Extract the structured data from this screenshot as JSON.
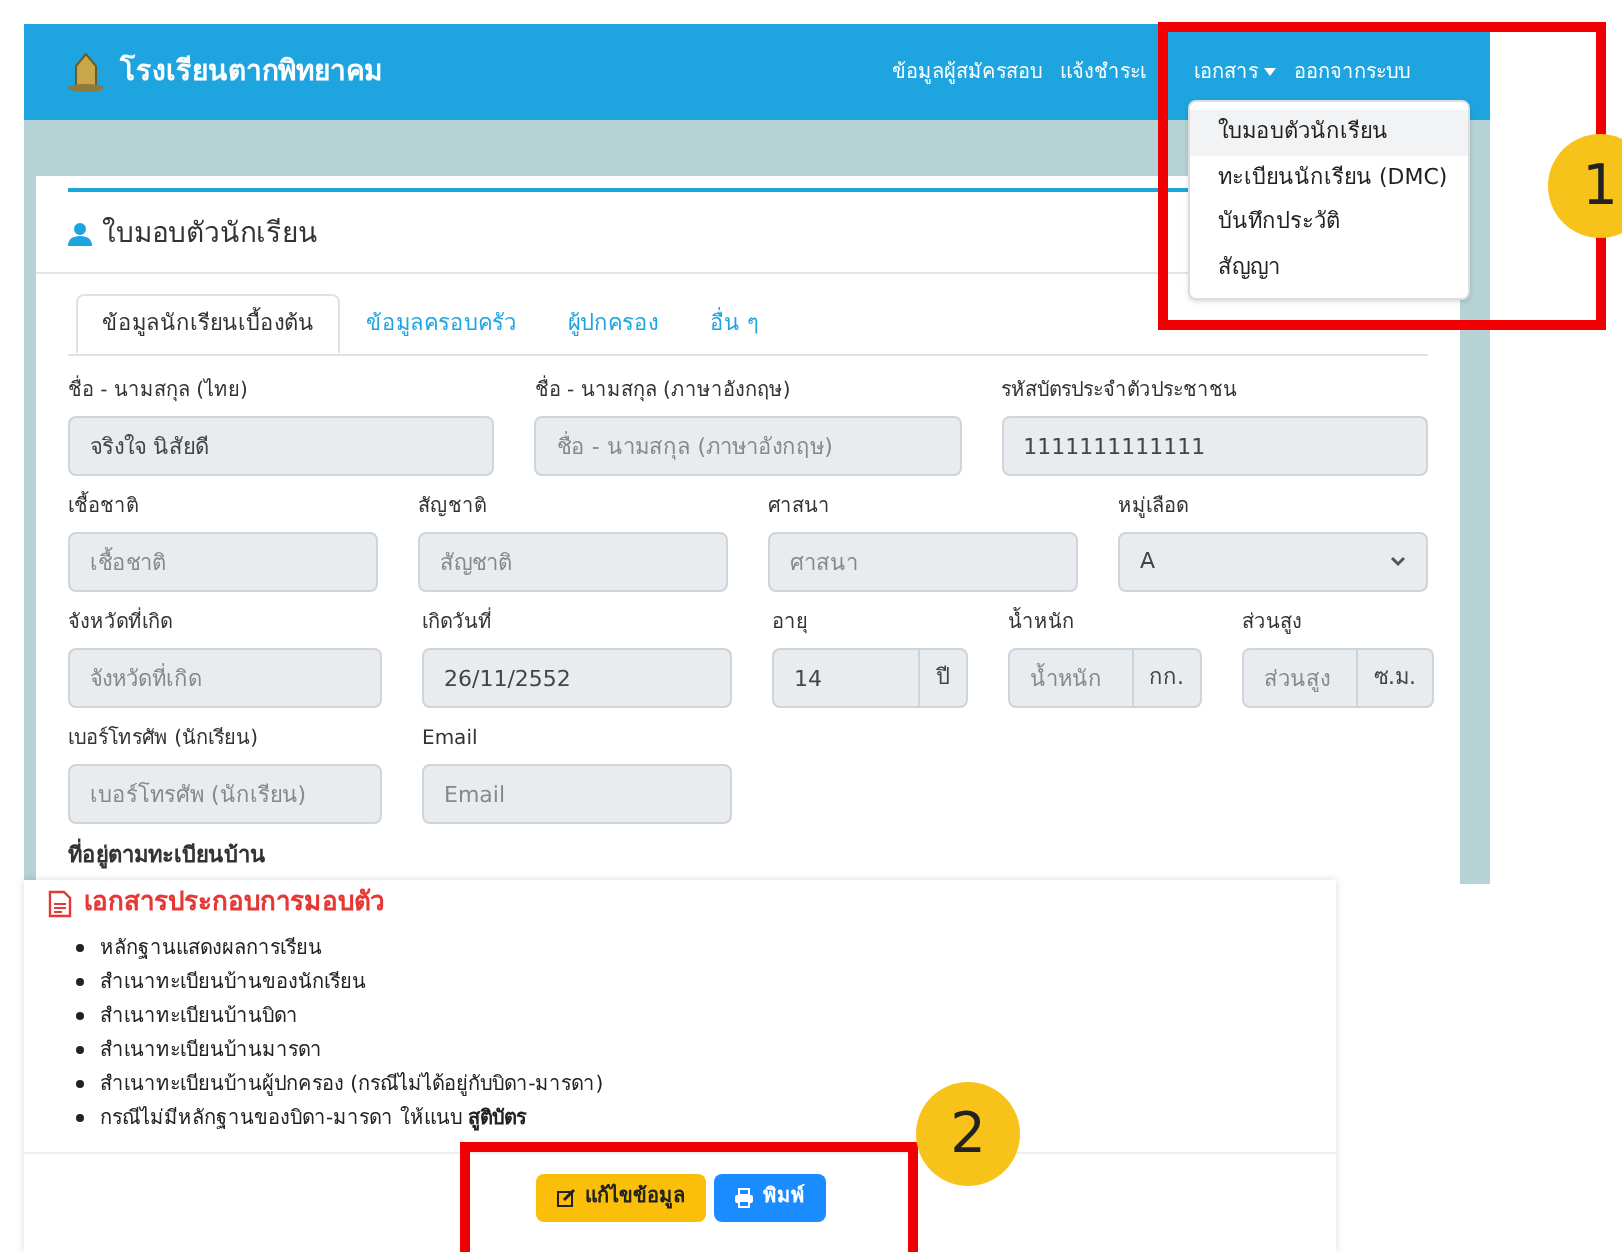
{
  "navbar": {
    "brand": "โรงเรียนตากพิทยาคม",
    "links": [
      {
        "label": "ข้อมูลผู้สมัครสอบ",
        "dropdown": false
      },
      {
        "label": "แจ้งชำระเ",
        "dropdown": false
      },
      {
        "label": "เอกสาร",
        "dropdown": true
      },
      {
        "label": "ออกจากระบบ",
        "dropdown": false
      }
    ]
  },
  "dropdown": {
    "items": [
      {
        "label": "ใบมอบตัวนักเรียน",
        "selected": true
      },
      {
        "label": "ทะเบียนนักเรียน (DMC)",
        "selected": false
      },
      {
        "label": "บันทึกประวัติ",
        "selected": false
      },
      {
        "label": "สัญญา",
        "selected": false
      }
    ]
  },
  "card": {
    "title": "ใบมอบตัวนักเรียน",
    "tabs": [
      {
        "label": "ข้อมูลนักเรียนเบื้องต้น",
        "selected": true
      },
      {
        "label": "ข้อมูลครอบครัว",
        "selected": false
      },
      {
        "label": "ผู้ปกครอง",
        "selected": false
      },
      {
        "label": "อื่น ๆ",
        "selected": false
      }
    ],
    "field_groups": [
      {
        "fields": [
          {
            "kind": "input",
            "label": "ชื่อ - นามสกุล (ไทย)",
            "value": "จริงใจ นิสัยดี"
          },
          {
            "kind": "input",
            "label": "ชื่อ - นามสกุล (ภาษาอังกฤษ)",
            "placeholder": "ชื่อ - นามสกุล (ภาษาอังกฤษ)"
          },
          {
            "kind": "input",
            "label": "รหัสบัตรประจำตัวประชาชน",
            "value": "1111111111111"
          }
        ]
      },
      {
        "fields": [
          {
            "kind": "input",
            "label": "เชื้อชาติ",
            "placeholder": "เชื้อชาติ"
          },
          {
            "kind": "input",
            "label": "สัญชาติ",
            "placeholder": "สัญชาติ"
          },
          {
            "kind": "input",
            "label": "ศาสนา",
            "placeholder": "ศาสนา"
          },
          {
            "kind": "select",
            "label": "หมู่เลือด",
            "value": "A"
          }
        ]
      },
      {
        "fields": [
          {
            "kind": "input",
            "label": "จังหวัดที่เกิด",
            "placeholder": "จังหวัดที่เกิด"
          },
          {
            "kind": "input",
            "label": "เกิดวันที่",
            "value": "26/11/2552"
          },
          {
            "kind": "addon",
            "label": "อายุ",
            "value": "14",
            "suffix": "ปี"
          },
          {
            "kind": "addon",
            "label": "น้ำหนัก",
            "placeholder": "น้ำหนัก",
            "suffix": "กก."
          },
          {
            "kind": "addon",
            "label": "ส่วนสูง",
            "placeholder": "ส่วนสูง",
            "suffix": "ซ.ม."
          }
        ]
      },
      {
        "fields": [
          {
            "kind": "input",
            "label": "เบอร์โทรศัพ (นักเรียน)",
            "placeholder": "เบอร์โทรศัพ (นักเรียน)"
          },
          {
            "kind": "input",
            "label": "Email",
            "placeholder": "Email"
          }
        ]
      }
    ],
    "address_label": "ที่อยู่ตามทะเบียนบ้าน"
  },
  "documents": {
    "title": "เอกสารประกอบการมอบตัว",
    "items": [
      "หลักฐานแสดงผลการเรียน",
      "สำเนาทะเบียนบ้านของนักเรียน",
      "สำเนาทะเบียนบ้านบิดา",
      "สำเนาทะเบียนบ้านมารดา",
      "สำเนาทะเบียนบ้านผู้ปกครอง (กรณีไม่ได้อยู่กับบิดา-มารดา)",
      "กรณีไม่มีหลักฐานของบิดา-มารดา ให้แนบ **สูติบัตร**"
    ],
    "buttons": [
      {
        "label": "แก้ไขข้อมูล",
        "kind": "warning"
      },
      {
        "label": "พิมพ์",
        "kind": "primary"
      }
    ]
  },
  "annotations": [
    {
      "number": "1"
    },
    {
      "number": "2"
    }
  ]
}
